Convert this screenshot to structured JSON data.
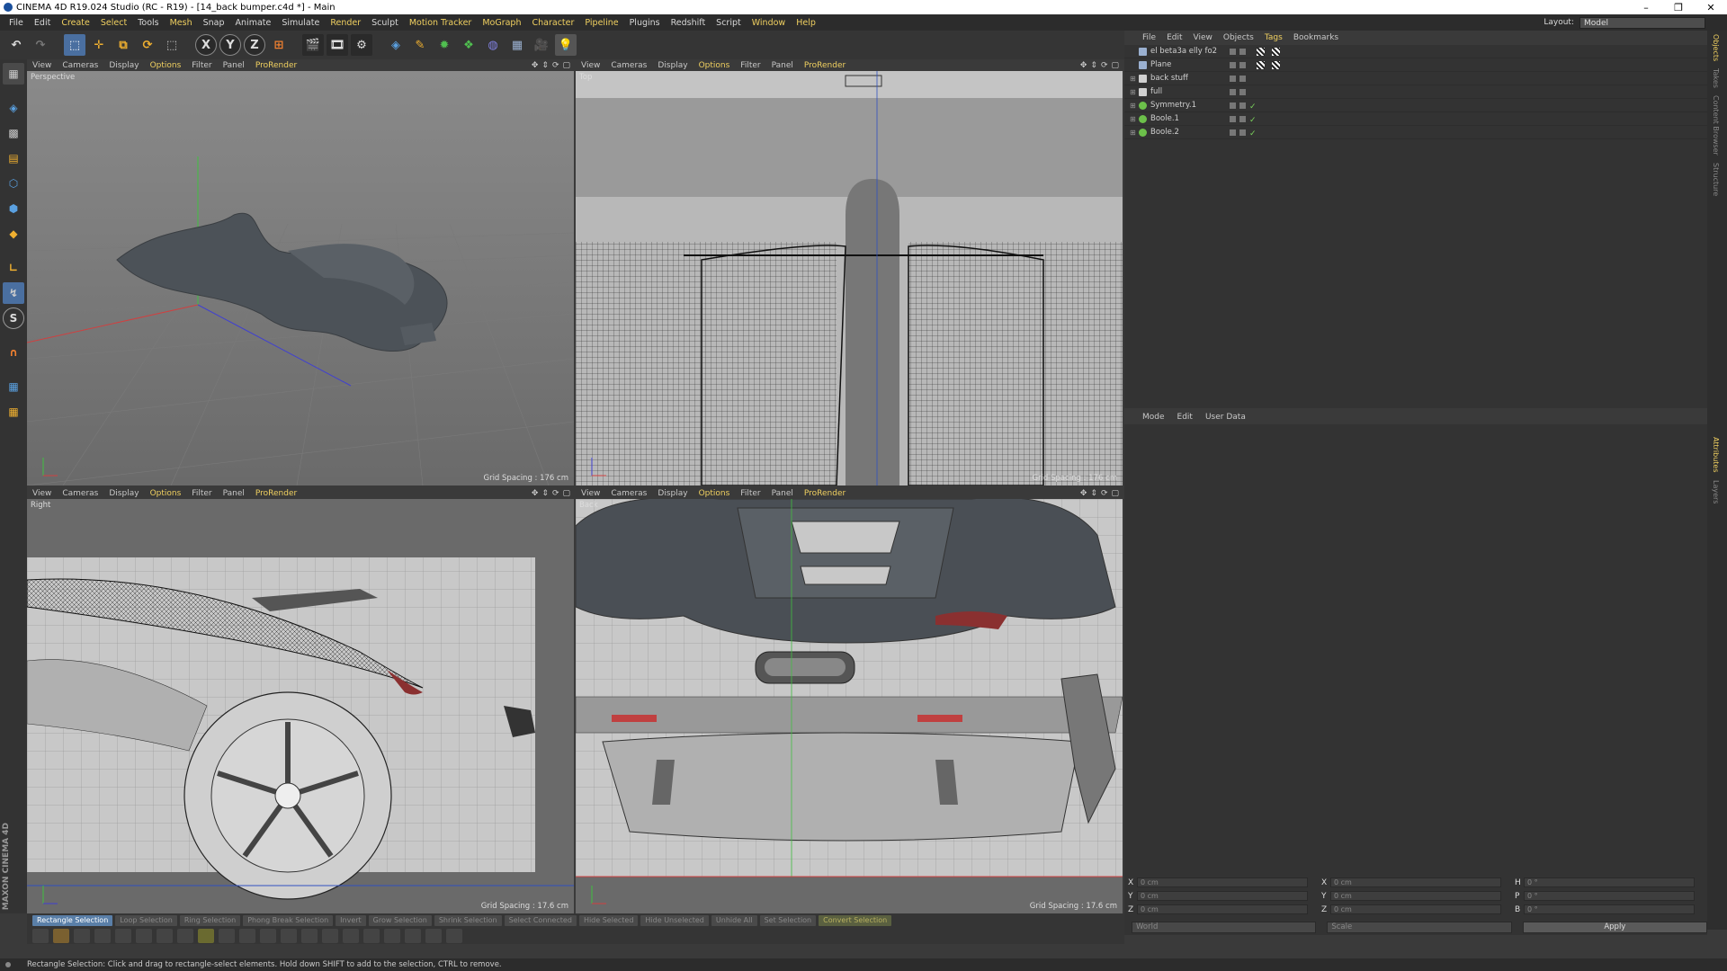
{
  "window": {
    "title": "CINEMA 4D R19.024 Studio (RC - R19) - [14_back bumper.c4d *] - Main",
    "minimize": "–",
    "restore": "❐",
    "close": "✕"
  },
  "menu": {
    "items": [
      "File",
      "Edit",
      "Create",
      "Select",
      "Tools",
      "Mesh",
      "Snap",
      "Animate",
      "Simulate",
      "Render",
      "Sculpt",
      "Motion Tracker",
      "MoGraph",
      "Character",
      "Pipeline",
      "Plugins",
      "Redshift",
      "Script",
      "Window",
      "Help"
    ],
    "layout_label": "Layout:",
    "layout_value": "Model"
  },
  "toolbar": {
    "x_label": "X",
    "y_label": "Y",
    "z_label": "Z"
  },
  "viewport_menu": {
    "view": "View",
    "cameras": "Cameras",
    "display": "Display",
    "options": "Options",
    "filter": "Filter",
    "panel": "Panel",
    "prorender": "ProRender"
  },
  "viewports": [
    {
      "label": "Perspective",
      "grid": "Grid Spacing : 176 cm"
    },
    {
      "label": "Top",
      "grid": "Grid Spacing : 176 cm"
    },
    {
      "label": "Right",
      "grid": "Grid Spacing : 17.6 cm"
    },
    {
      "label": "Back",
      "grid": "Grid Spacing : 17.6 cm"
    }
  ],
  "object_manager": {
    "menu": [
      "File",
      "Edit",
      "View",
      "Objects",
      "Tags",
      "Bookmarks"
    ],
    "objects": [
      {
        "name": "el beta3a elly fo2",
        "color": "#9ab0d0"
      },
      {
        "name": "Plane",
        "color": "#9ab0d0"
      },
      {
        "name": "back stuff",
        "color": "#d0d0d0"
      },
      {
        "name": "full",
        "color": "#d0d0d0"
      },
      {
        "name": "Symmetry.1",
        "color": "#6cc04a"
      },
      {
        "name": "Boole.1",
        "color": "#6cc04a"
      },
      {
        "name": "Boole.2",
        "color": "#6cc04a"
      }
    ]
  },
  "attributes": {
    "menu": [
      "Mode",
      "Edit",
      "User Data"
    ]
  },
  "coordinates": {
    "rows": [
      {
        "a": "X",
        "av": "0 cm",
        "b": "X",
        "bv": "0 cm",
        "c": "H",
        "cv": "0 °"
      },
      {
        "a": "Y",
        "av": "0 cm",
        "b": "Y",
        "bv": "0 cm",
        "c": "P",
        "cv": "0 °"
      },
      {
        "a": "Z",
        "av": "0 cm",
        "b": "Z",
        "bv": "0 cm",
        "c": "B",
        "cv": "0 °"
      }
    ],
    "world": "World",
    "scale": "Scale",
    "apply": "Apply"
  },
  "right_tabs": [
    "Objects",
    "Takes",
    "Content Browser",
    "Structure",
    "Attributes",
    "Layers"
  ],
  "modes": [
    "Rectangle Selection",
    "Loop Selection",
    "Ring Selection",
    "Phong Break Selection",
    "Invert",
    "Grow Selection",
    "Shrink Selection",
    "Select Connected",
    "Hide Selected",
    "Hide Unselected",
    "Unhide All",
    "Set Selection",
    "Convert Selection"
  ],
  "branding": {
    "maxon": "MAXON CINEMA 4D"
  },
  "status": "Rectangle Selection: Click and drag to rectangle-select elements. Hold down SHIFT to add to the selection, CTRL to remove."
}
